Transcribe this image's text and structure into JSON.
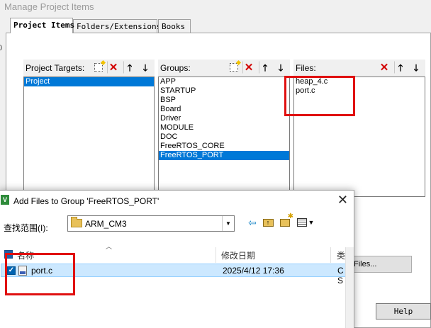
{
  "manage_dialog": {
    "title": "Manage Project Items",
    "tabs": [
      "Project Items",
      "Folders/Extensions",
      "Books"
    ],
    "side_label": "0",
    "project_targets": {
      "label": "Project Targets:",
      "items": [
        "Project"
      ],
      "selected": "Project"
    },
    "groups": {
      "label": "Groups:",
      "items": [
        "APP",
        "STARTUP",
        "BSP",
        "Board",
        "Driver",
        "MODULE",
        "DOC",
        "FreeRTOS_CORE",
        "FreeRTOS_PORT"
      ],
      "selected": "FreeRTOS_PORT"
    },
    "files": {
      "label": "Files:",
      "items": [
        "heap_4.c",
        "port.c"
      ]
    },
    "add_files_button": "Files...",
    "help_button": "Help",
    "toolbar_icons": {
      "new": "new-item-icon",
      "delete": "delete-icon",
      "move_up": "arrow-up-icon",
      "move_down": "arrow-down-icon"
    },
    "highlight_color": "#e01010",
    "selection_color": "#0078d7"
  },
  "add_files_dialog": {
    "title": "Add Files to Group 'FreeRTOS_PORT'",
    "close_symbol": "✕",
    "look_in_label": "查找范围(I):",
    "look_in_value": "ARM_CM3",
    "columns": {
      "name": "名称",
      "date": "修改日期",
      "type": "类"
    },
    "files": [
      {
        "name": "port.c",
        "date": "2025/4/12 17:36",
        "type": "C S",
        "checked": true
      }
    ],
    "row_selection_color": "#cce8ff"
  }
}
